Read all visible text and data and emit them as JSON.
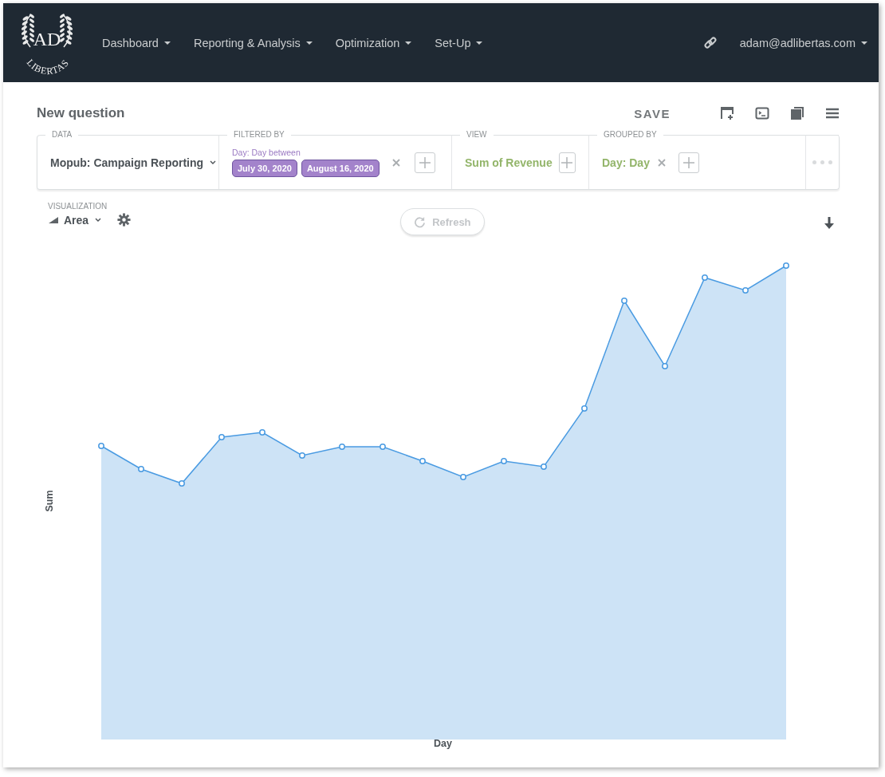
{
  "logo": {
    "top": "AD",
    "bottom": "LIBERTAS"
  },
  "nav": {
    "items": [
      {
        "label": "Dashboard"
      },
      {
        "label": "Reporting & Analysis"
      },
      {
        "label": "Optimization"
      },
      {
        "label": "Set-Up"
      }
    ],
    "user": "adam@adlibertas.com"
  },
  "question": {
    "title": "New question",
    "save": "SAVE"
  },
  "query": {
    "data": {
      "label": "DATA",
      "value": "Mopub: Campaign Reporting"
    },
    "filter": {
      "label": "FILTERED BY",
      "title": "Day: Day between",
      "pills": [
        "July 30, 2020",
        "August 16, 2020"
      ]
    },
    "view": {
      "label": "VIEW",
      "value": "Sum of Revenue"
    },
    "grouped": {
      "label": "GROUPED BY",
      "value": "Day: Day"
    }
  },
  "visualization": {
    "label": "VISUALIZATION",
    "type": "Area"
  },
  "refresh": {
    "label": "Refresh",
    "disabled": true
  },
  "chart": {
    "ylabel": "Sum",
    "xlabel": "Day"
  }
}
